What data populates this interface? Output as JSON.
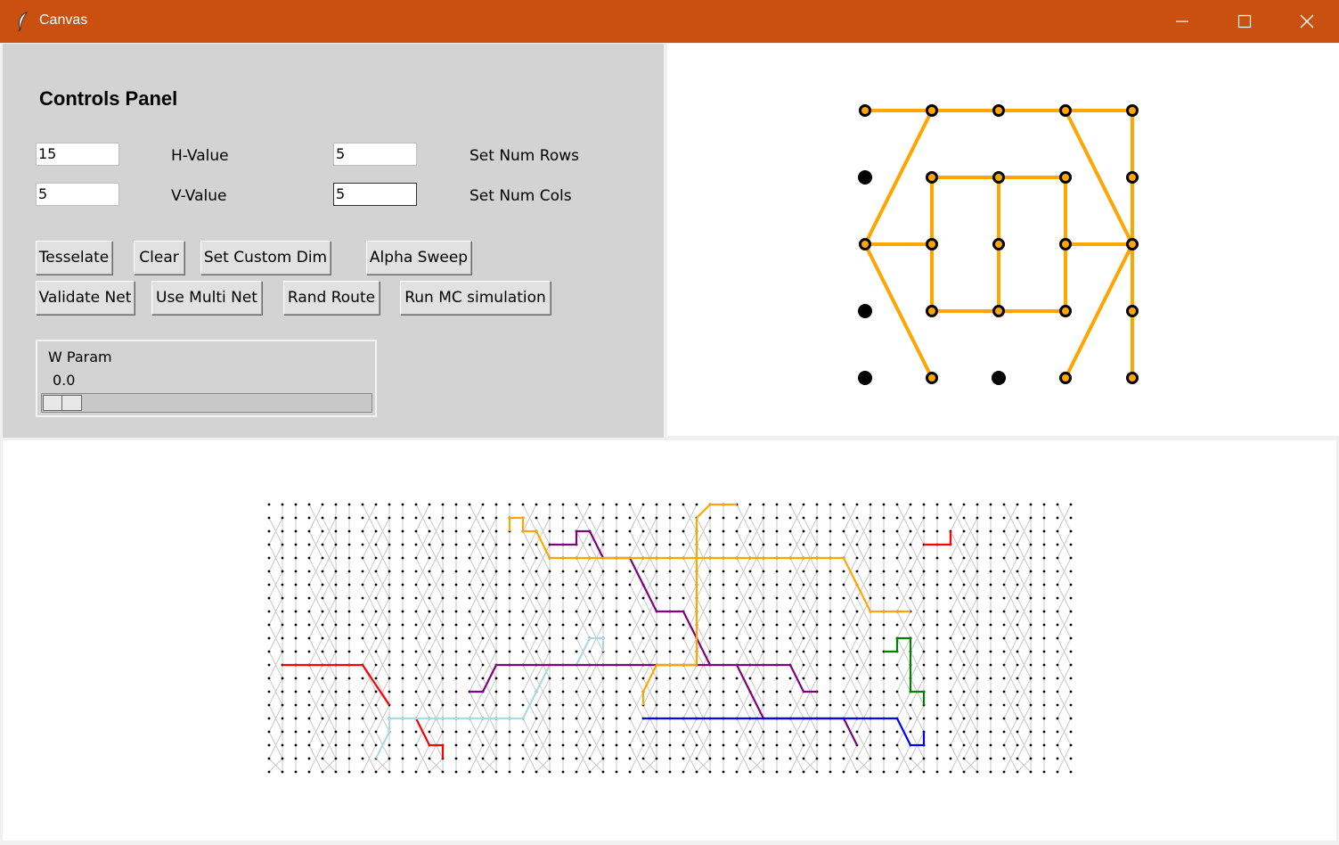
{
  "window": {
    "title": "Canvas",
    "icons": {
      "app": "feather-icon",
      "minimize": "minimize-icon",
      "maximize": "maximize-icon",
      "close": "close-icon"
    },
    "accent": "#c9500f"
  },
  "controls": {
    "heading": "Controls Panel",
    "h_value": {
      "value": "15",
      "label": "H-Value"
    },
    "v_value": {
      "value": "5",
      "label": "V-Value"
    },
    "num_rows": {
      "value": "5",
      "label": "Set Num Rows"
    },
    "num_cols": {
      "value": "5",
      "label": "Set Num Cols"
    },
    "buttons": {
      "tesselate": "Tesselate",
      "clear": "Clear",
      "set_custom_dim": "Set Custom Dim",
      "alpha_sweep": "Alpha Sweep",
      "validate_net": "Validate Net",
      "use_multi_net": "Use Multi Net",
      "rand_route": "Rand Route",
      "run_mc": "Run MC simulation"
    },
    "w_param": {
      "label": "W Param",
      "value": "0.0",
      "fraction": 0.0
    }
  },
  "net_graph": {
    "rows": 5,
    "cols": 5,
    "node_color": "#000000",
    "active_color": "#ffa500",
    "active_nodes": [
      [
        0,
        0
      ],
      [
        0,
        1
      ],
      [
        0,
        2
      ],
      [
        0,
        3
      ],
      [
        0,
        4
      ],
      [
        1,
        1
      ],
      [
        1,
        2
      ],
      [
        1,
        3
      ],
      [
        1,
        4
      ],
      [
        2,
        0
      ],
      [
        2,
        1
      ],
      [
        2,
        2
      ],
      [
        2,
        3
      ],
      [
        2,
        4
      ],
      [
        3,
        1
      ],
      [
        3,
        2
      ],
      [
        3,
        3
      ],
      [
        3,
        4
      ],
      [
        4,
        1
      ],
      [
        4,
        3
      ],
      [
        4,
        4
      ]
    ],
    "edges": [
      [
        [
          0,
          0
        ],
        [
          0,
          1
        ]
      ],
      [
        [
          0,
          1
        ],
        [
          0,
          2
        ]
      ],
      [
        [
          0,
          2
        ],
        [
          0,
          3
        ]
      ],
      [
        [
          0,
          3
        ],
        [
          0,
          4
        ]
      ],
      [
        [
          0,
          1
        ],
        [
          2,
          0
        ]
      ],
      [
        [
          0,
          3
        ],
        [
          2,
          4
        ]
      ],
      [
        [
          0,
          4
        ],
        [
          1,
          4
        ]
      ],
      [
        [
          1,
          4
        ],
        [
          2,
          4
        ]
      ],
      [
        [
          1,
          1
        ],
        [
          1,
          2
        ]
      ],
      [
        [
          1,
          2
        ],
        [
          1,
          3
        ]
      ],
      [
        [
          1,
          1
        ],
        [
          2,
          1
        ]
      ],
      [
        [
          2,
          1
        ],
        [
          3,
          1
        ]
      ],
      [
        [
          1,
          2
        ],
        [
          2,
          2
        ]
      ],
      [
        [
          2,
          2
        ],
        [
          3,
          2
        ]
      ],
      [
        [
          1,
          3
        ],
        [
          2,
          3
        ]
      ],
      [
        [
          2,
          3
        ],
        [
          3,
          3
        ]
      ],
      [
        [
          2,
          0
        ],
        [
          2,
          1
        ]
      ],
      [
        [
          2,
          3
        ],
        [
          2,
          4
        ]
      ],
      [
        [
          3,
          1
        ],
        [
          3,
          2
        ]
      ],
      [
        [
          3,
          2
        ],
        [
          3,
          3
        ]
      ],
      [
        [
          2,
          0
        ],
        [
          4,
          1
        ]
      ],
      [
        [
          2,
          4
        ],
        [
          4,
          3
        ]
      ],
      [
        [
          2,
          4
        ],
        [
          3,
          4
        ]
      ],
      [
        [
          3,
          4
        ],
        [
          4,
          4
        ]
      ]
    ]
  },
  "routing_grid": {
    "cols": 61,
    "rows": 21,
    "dot_color": "#000000",
    "mesh_color": "#c8c8c8",
    "nets": [
      {
        "color": "#ff0000",
        "points": [
          [
            1,
            12
          ],
          [
            7,
            12
          ],
          [
            9,
            15
          ]
        ]
      },
      {
        "color": "#ff0000",
        "points": [
          [
            11,
            16
          ],
          [
            12,
            18
          ],
          [
            13,
            18
          ],
          [
            13,
            19
          ]
        ]
      },
      {
        "color": "#ff0000",
        "points": [
          [
            49,
            3
          ],
          [
            51,
            3
          ],
          [
            51,
            2
          ]
        ]
      },
      {
        "color": "#add8e6",
        "points": [
          [
            8,
            19
          ],
          [
            9,
            17
          ],
          [
            9,
            16
          ],
          [
            10,
            16
          ],
          [
            19,
            16
          ],
          [
            21,
            12
          ],
          [
            23,
            12
          ],
          [
            24,
            10
          ],
          [
            25,
            10
          ],
          [
            25,
            11
          ]
        ]
      },
      {
        "color": "#800080",
        "points": [
          [
            15,
            14
          ],
          [
            16,
            14
          ],
          [
            17,
            12
          ],
          [
            39,
            12
          ],
          [
            40,
            14
          ],
          [
            41,
            14
          ]
        ]
      },
      {
        "color": "#800080",
        "points": [
          [
            21,
            3
          ],
          [
            23,
            3
          ],
          [
            23,
            2
          ],
          [
            24,
            2
          ],
          [
            25,
            4
          ],
          [
            27,
            4
          ],
          [
            29,
            8
          ],
          [
            31,
            8
          ],
          [
            32,
            10
          ],
          [
            33,
            12
          ]
        ]
      },
      {
        "color": "#800080",
        "points": [
          [
            35,
            12
          ],
          [
            37,
            16
          ],
          [
            43,
            16
          ],
          [
            44,
            18
          ]
        ]
      },
      {
        "color": "#ffa500",
        "points": [
          [
            18,
            2
          ],
          [
            18,
            1
          ],
          [
            19,
            1
          ],
          [
            19,
            2
          ],
          [
            20,
            2
          ],
          [
            21,
            4
          ],
          [
            43,
            4
          ],
          [
            45,
            8
          ],
          [
            48,
            8
          ]
        ]
      },
      {
        "color": "#ffa500",
        "points": [
          [
            32,
            1
          ],
          [
            33,
            0
          ],
          [
            35,
            0
          ]
        ]
      },
      {
        "color": "#ffa500",
        "points": [
          [
            32,
            1
          ],
          [
            32,
            12
          ],
          [
            31,
            12
          ],
          [
            29,
            12
          ],
          [
            28,
            14
          ],
          [
            28,
            15
          ]
        ]
      },
      {
        "color": "#0000ff",
        "points": [
          [
            28,
            16
          ],
          [
            47,
            16
          ],
          [
            48,
            18
          ],
          [
            49,
            18
          ],
          [
            49,
            17
          ]
        ]
      },
      {
        "color": "#008000",
        "points": [
          [
            46,
            11
          ],
          [
            47,
            11
          ],
          [
            47,
            10
          ],
          [
            48,
            10
          ],
          [
            48,
            14
          ],
          [
            49,
            14
          ],
          [
            49,
            15
          ]
        ]
      }
    ]
  }
}
